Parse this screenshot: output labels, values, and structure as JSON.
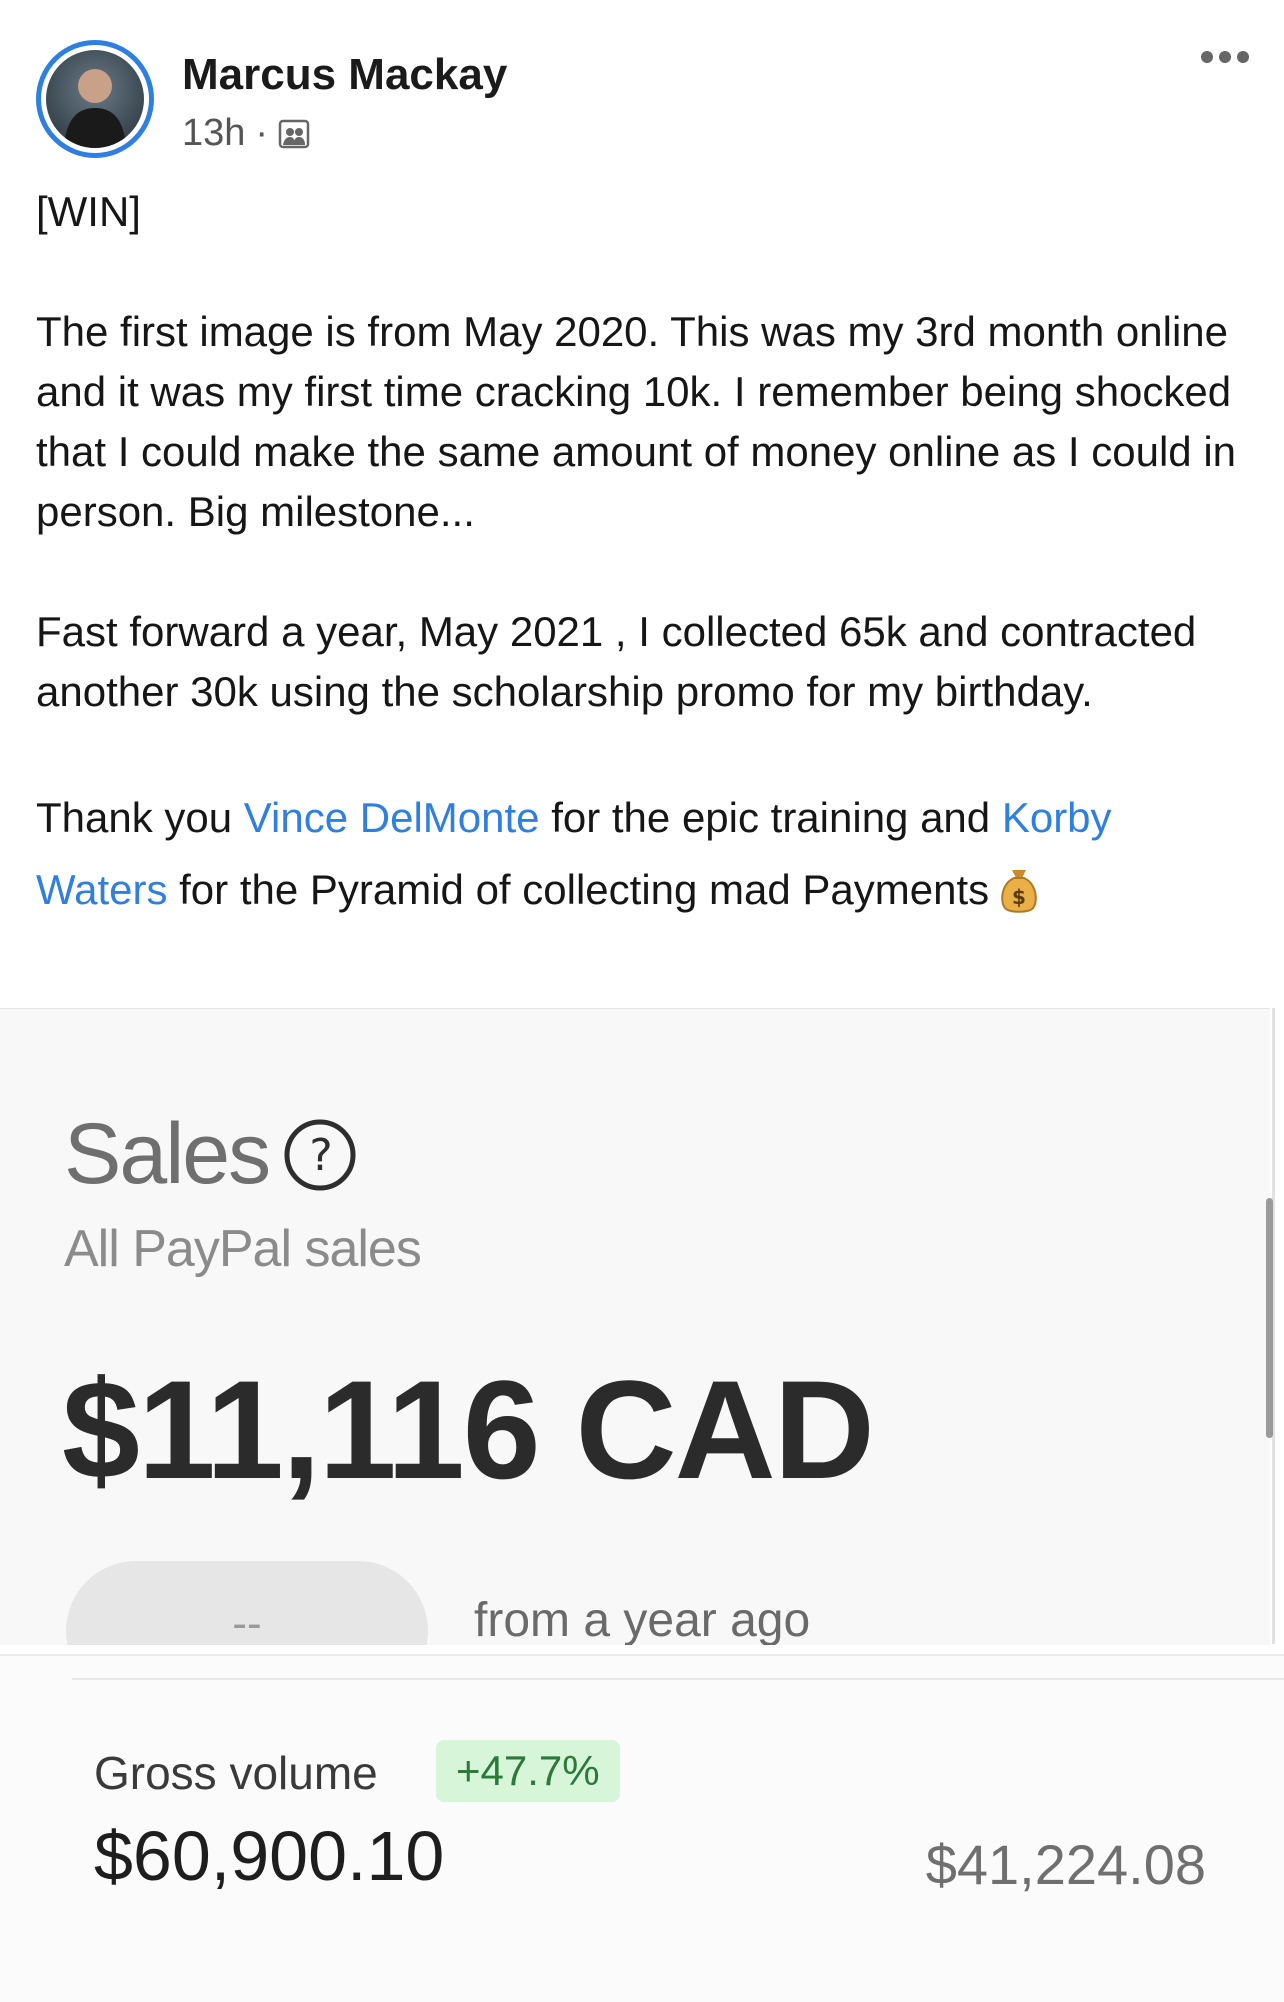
{
  "post": {
    "author": "Marcus Mackay",
    "time": "13h",
    "separator": "·",
    "audience_icon": "group-icon",
    "more_icon": "more-dots-icon",
    "tag": "[WIN]",
    "p1": "The first image is from May 2020. This was my 3rd month online and it was my first time cracking 10k. I remember being shocked that I could make the same amount of money online as I could in person. Big milestone...",
    "p2": "Fast forward a year, May 2021 , I collected 65k and contracted another 30k using the scholarship promo for my birthday.",
    "p3_start": "Thank you ",
    "mention1": "Vince DelMonte",
    "p3_mid": " for the epic training and ",
    "mention2": "Korby Waters",
    "p3_end": " for the Pyramid of collecting mad Payments",
    "emoji_icon": "money-bag-icon"
  },
  "image1": {
    "title": "Sales",
    "help_icon": "question-circle-icon",
    "subtitle": "All PayPal sales",
    "amount": "$11,116 CAD",
    "pill_text": "--",
    "compare_text": "from a year ago"
  },
  "image2": {
    "label": "Gross volume",
    "change": "+47.7%",
    "value": "$60,900.10",
    "previous": "$41,224.08"
  },
  "colors": {
    "link": "#2f7fe0",
    "badge_bg": "#d6f5d9",
    "badge_text": "#2c7a3a"
  }
}
